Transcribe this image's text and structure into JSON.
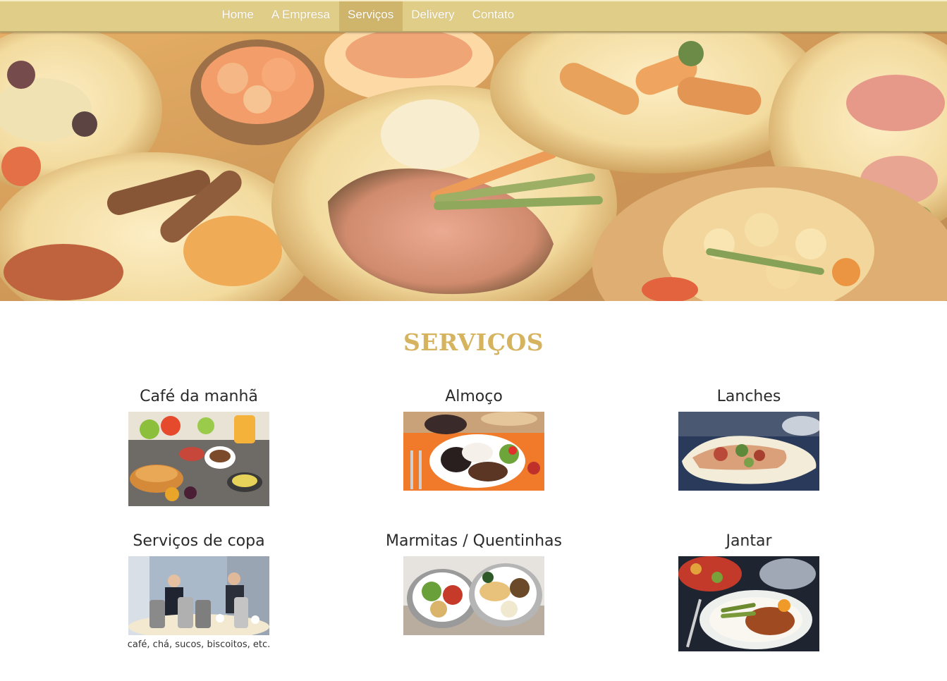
{
  "nav": {
    "items": [
      {
        "label": "Home"
      },
      {
        "label": "A Empresa"
      },
      {
        "label": "Serviços"
      },
      {
        "label": "Delivery"
      },
      {
        "label": "Contato"
      }
    ],
    "active_index": 2
  },
  "section": {
    "title": "SERVIÇOS"
  },
  "services": [
    {
      "title": "Café da manhã",
      "caption": ""
    },
    {
      "title": "Almoço",
      "caption": ""
    },
    {
      "title": "Lanches",
      "caption": ""
    },
    {
      "title": "Serviços de copa",
      "caption": "café, chá, sucos, biscoitos, etc."
    },
    {
      "title": "Marmitas / Quentinhas",
      "caption": ""
    },
    {
      "title": "Jantar",
      "caption": ""
    }
  ],
  "colors": {
    "nav_bg": "#e0cd88",
    "nav_active": "#cfb46c",
    "title_gold": "#d6b35e"
  }
}
